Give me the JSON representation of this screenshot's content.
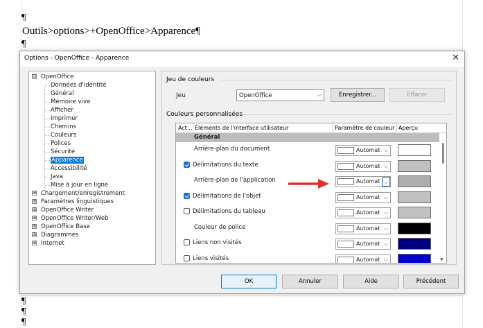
{
  "document": {
    "pilcrow": "¶",
    "heading": "Outils>options>+OpenOffice>Apparence¶"
  },
  "dialog": {
    "title": "Options - OpenOffice - Apparence",
    "close_icon": "close-icon"
  },
  "tree": {
    "root": {
      "expander": "⊟",
      "label": "OpenOffice"
    },
    "children": [
      "Données d'identité",
      "Général",
      "Mémoire vive",
      "Afficher",
      "Imprimer",
      "Chemins",
      "Couleurs",
      "Polices",
      "Sécurité",
      "Apparence",
      "Accessibilité",
      "Java",
      "Mise à jour en ligne"
    ],
    "selected": "Apparence",
    "others": [
      {
        "expander": "⊞",
        "label": "Chargement/enregistrement"
      },
      {
        "expander": "⊞",
        "label": "Paramètres linguistiques"
      },
      {
        "expander": "⊞",
        "label": "OpenOffice Writer"
      },
      {
        "expander": "⊞",
        "label": "OpenOffice Writer/Web"
      },
      {
        "expander": "⊞",
        "label": "OpenOffice Base"
      },
      {
        "expander": "⊞",
        "label": "Diagrammes"
      },
      {
        "expander": "⊞",
        "label": "Internet"
      }
    ]
  },
  "scheme": {
    "group_label": "Jeu de couleurs",
    "jeu_label": "Jeu",
    "selected": "OpenOffice",
    "save_label": "Enregistrer...",
    "delete_label": "Effacer"
  },
  "custom": {
    "group_label": "Couleurs personnalisées",
    "headers": {
      "active": "Act...",
      "element": "Éléments de l'interface utilisateur",
      "param": "Paramètre de couleur",
      "preview": "Aperçu"
    },
    "section": "Général",
    "rows": [
      {
        "label": "Arrière-plan du document",
        "checkbox": null,
        "value": "Automatique",
        "preview_color": "#ffffff"
      },
      {
        "label": "Délimitations du texte",
        "checkbox": true,
        "value": "Automatique",
        "preview_color": "#c0c0c0"
      },
      {
        "label": "Arrière-plan de l'application",
        "checkbox": null,
        "value": "Automatique",
        "preview_color": "#adadad"
      },
      {
        "label": "Délimitations de l'objet",
        "checkbox": true,
        "value": "Automatique",
        "preview_color": "#c0c0c0"
      },
      {
        "label": "Délimitations du tableau",
        "checkbox": false,
        "value": "Automatique",
        "preview_color": "#c0c0c0"
      },
      {
        "label": "Couleur de police",
        "checkbox": null,
        "value": "Automatique",
        "preview_color": "#000000"
      },
      {
        "label": "Liens non visités",
        "checkbox": false,
        "value": "Automatique",
        "preview_color": "#000080"
      },
      {
        "label": "Liens visités",
        "checkbox": false,
        "value": "Automatique",
        "preview_color": "#0000cc"
      }
    ]
  },
  "buttons": {
    "ok": "OK",
    "cancel": "Annuler",
    "help": "Aide",
    "back": "Précédent"
  },
  "colors": {
    "accent": "#0078d7",
    "arrow": "#e03030"
  }
}
